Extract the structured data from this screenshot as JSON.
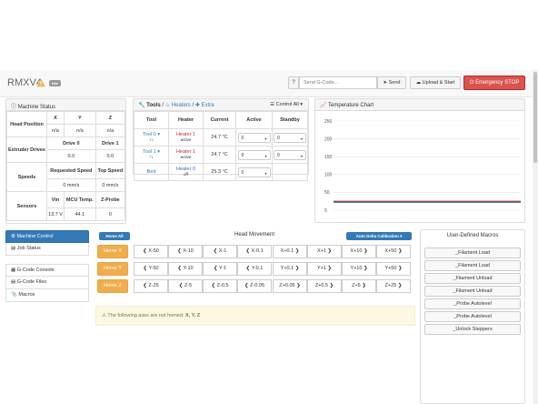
{
  "header": {
    "brand": "RMXV4",
    "badge": "idle",
    "help": "?",
    "gcode_placeholder": "Send G-Code...",
    "send": "Send",
    "upload": "Upload & Start",
    "estop": "Emergency STOP"
  },
  "machine_status": {
    "title": "Machine Status",
    "axes": [
      "X",
      "Y",
      "Z"
    ],
    "head_position_label": "Head Position",
    "head_position": [
      "n/a",
      "n/a",
      "n/a"
    ],
    "extruder_label": "Extruder Drives",
    "drive0": "Drive 0",
    "drive1": "Drive 1",
    "drive0_val": "0.0",
    "drive1_val": "0.0",
    "speeds_label": "Speeds",
    "requested_speed": "Requested Speed",
    "top_speed": "Top Speed",
    "requested_val": "0 mm/s",
    "top_val": "0 mm/s",
    "sensors_label": "Sensors",
    "vin": "Vin",
    "mcu": "MCU Temp.",
    "zprobe": "Z-Probe",
    "vin_val": "13.7 V",
    "mcu_val": "44.1",
    "zprobe_val": "0"
  },
  "tools": {
    "tab_tools": "Tools",
    "sep1": "/",
    "tab_heaters": "Heaters",
    "sep2": "/",
    "tab_extra": "Extra",
    "control_all": "Control All",
    "headers": [
      "Tool",
      "Heater",
      "Current",
      "Active",
      "Standby"
    ],
    "rows": [
      {
        "tool": "Tool 0",
        "sub": "T0",
        "heater": "Heater 1",
        "state": "active",
        "current": "24.7 °C",
        "active": "0",
        "standby": "0"
      },
      {
        "tool": "Tool 1",
        "sub": "T1",
        "heater": "Heater 1",
        "state": "active",
        "current": "24.7 °C",
        "active": "0",
        "standby": "0"
      }
    ],
    "bed": {
      "tool": "Bed",
      "heater": "Heater 0",
      "state": "off",
      "current": "25.3 °C",
      "active": "0"
    }
  },
  "temperature_chart": {
    "title": "Temperature Chart"
  },
  "chart_data": {
    "type": "line",
    "yticks": [
      "250",
      "200",
      "150",
      "100",
      "50",
      "0"
    ],
    "ylim": [
      0,
      250
    ],
    "series": [
      {
        "values": [
          25,
          25
        ]
      },
      {
        "values": [
          25,
          25
        ]
      }
    ],
    "colors": [
      "#c0392b",
      "#1f4e79"
    ]
  },
  "sidenav": {
    "items": [
      "Machine Control",
      "Job Status",
      "G-Code Console",
      "G-Code Files",
      "Macros"
    ]
  },
  "head_movement": {
    "home_all": "Home All",
    "title": "Head Movement",
    "auto_delta": "Auto Delta Calibration",
    "home": [
      "Home X",
      "Home Y",
      "Home Z"
    ],
    "x_minus": [
      "X-50",
      "X-10",
      "X-1",
      "X-0.1"
    ],
    "x_plus": [
      "X+0.1",
      "X+1",
      "X+10",
      "X+50"
    ],
    "y_minus": [
      "Y-50",
      "Y-10",
      "Y-1",
      "Y-0.1"
    ],
    "y_plus": [
      "Y+0.1",
      "Y+1",
      "Y+10",
      "Y+50"
    ],
    "z_minus": [
      "Z-25",
      "Z-5",
      "Z-0.5",
      "Z-0.05"
    ],
    "z_plus": [
      "Z+0.05",
      "Z+0.5",
      "Z+5",
      "Z+25"
    ]
  },
  "alert": {
    "text": "The following axes are not homed:",
    "axes": "X, Y, Z"
  },
  "macros": {
    "title": "User-Defined Macros",
    "items": [
      "_Filament Load",
      "_Filament Load",
      "_Filament Unload",
      "_Filament Unload",
      "_Probe Autolevel",
      "_Probe Autolevel",
      "_Unlock Steppers"
    ]
  }
}
